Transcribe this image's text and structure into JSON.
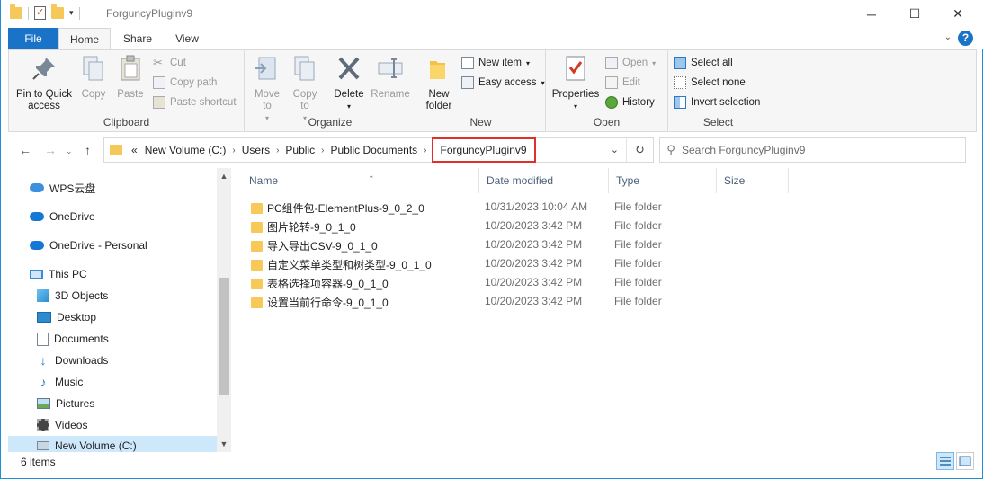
{
  "window": {
    "title": "ForguncyPluginv9",
    "minimize_glyph": "─",
    "maximize_glyph": "☐",
    "close_glyph": "✕",
    "accent_color": "#1a73c7"
  },
  "ribbon_tabs": [
    "File",
    "Home",
    "Share",
    "View"
  ],
  "ribbon": {
    "clipboard": {
      "label": "Clipboard",
      "pin": "Pin to Quick access",
      "copy": "Copy",
      "paste": "Paste",
      "cut": "Cut",
      "copy_path": "Copy path",
      "paste_shortcut": "Paste shortcut"
    },
    "organize": {
      "label": "Organize",
      "move_to": "Move to",
      "copy_to": "Copy to",
      "delete": "Delete",
      "rename": "Rename"
    },
    "new": {
      "label": "New",
      "new_folder": "New folder",
      "new_item": "New item",
      "easy_access": "Easy access"
    },
    "open": {
      "label": "Open",
      "properties": "Properties",
      "open": "Open",
      "edit": "Edit",
      "history": "History"
    },
    "select": {
      "label": "Select",
      "select_all": "Select all",
      "select_none": "Select none",
      "invert": "Invert selection"
    }
  },
  "address": {
    "path": [
      "New Volume (C:)",
      "Users",
      "Public",
      "Public Documents"
    ],
    "current": "ForguncyPluginv9",
    "overflow": "«"
  },
  "search": {
    "placeholder": "Search ForguncyPluginv9"
  },
  "nav": {
    "items": [
      {
        "label": "WPS云盘",
        "icon": "wps-cloud-icon"
      },
      {
        "label": "OneDrive",
        "icon": "onedrive-icon"
      },
      {
        "label": "OneDrive - Personal",
        "icon": "onedrive-icon"
      },
      {
        "label": "This PC",
        "icon": "computer-icon"
      },
      {
        "label": "3D Objects",
        "icon": "3d-objects-icon"
      },
      {
        "label": "Desktop",
        "icon": "desktop-icon"
      },
      {
        "label": "Documents",
        "icon": "documents-icon"
      },
      {
        "label": "Downloads",
        "icon": "downloads-icon"
      },
      {
        "label": "Music",
        "icon": "music-icon"
      },
      {
        "label": "Pictures",
        "icon": "pictures-icon"
      },
      {
        "label": "Videos",
        "icon": "videos-icon"
      },
      {
        "label": "New Volume (C:)",
        "icon": "drive-icon"
      }
    ]
  },
  "columns": [
    "Name",
    "Date modified",
    "Type",
    "Size"
  ],
  "files": [
    {
      "name": "PC组件包-ElementPlus-9_0_2_0",
      "date": "10/31/2023 10:04 AM",
      "type": "File folder"
    },
    {
      "name": "图片轮转-9_0_1_0",
      "date": "10/20/2023 3:42 PM",
      "type": "File folder"
    },
    {
      "name": "导入导出CSV-9_0_1_0",
      "date": "10/20/2023 3:42 PM",
      "type": "File folder"
    },
    {
      "name": "自定义菜单类型和树类型-9_0_1_0",
      "date": "10/20/2023 3:42 PM",
      "type": "File folder"
    },
    {
      "name": "表格选择项容器-9_0_1_0",
      "date": "10/20/2023 3:42 PM",
      "type": "File folder"
    },
    {
      "name": "设置当前行命令-9_0_1_0",
      "date": "10/20/2023 3:42 PM",
      "type": "File folder"
    }
  ],
  "status": {
    "count": "6 items"
  }
}
